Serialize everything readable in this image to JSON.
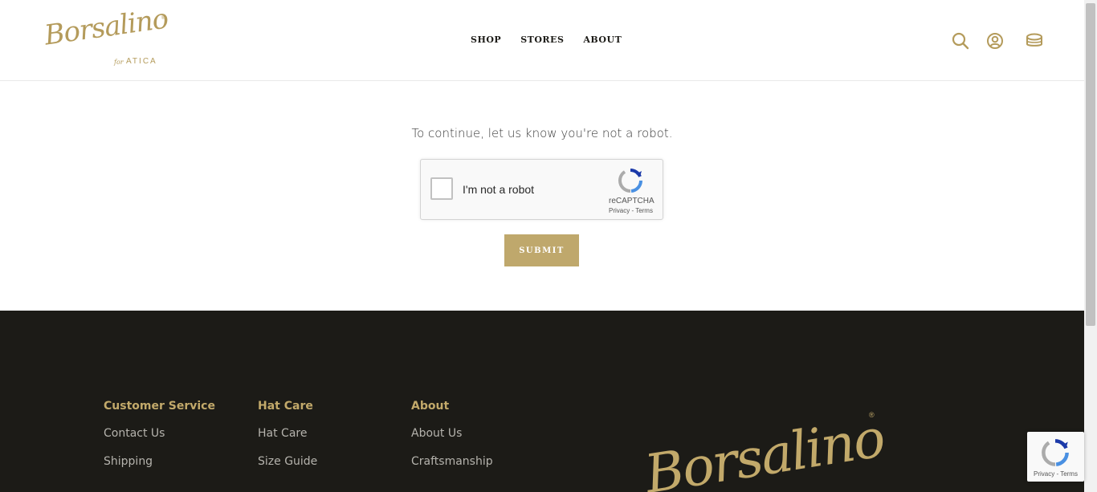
{
  "brand": {
    "script": "Borsalino",
    "reg": "®",
    "for": "for",
    "partner": "ATICA"
  },
  "nav": {
    "items": [
      "SHOP",
      "STORES",
      "ABOUT"
    ]
  },
  "header_icons": [
    "search-icon",
    "account-icon",
    "cart-icon"
  ],
  "main": {
    "prompt": "To continue, let us know you're not a robot.",
    "captcha": {
      "label": "I'm not a robot",
      "brand": "reCAPTCHA",
      "links": "Privacy - Terms"
    },
    "submit_label": "SUBMIT"
  },
  "footer": {
    "columns": [
      {
        "title": "Customer Service",
        "links": [
          "Contact Us",
          "Shipping"
        ]
      },
      {
        "title": "Hat Care",
        "links": [
          "Hat Care",
          "Size Guide"
        ]
      },
      {
        "title": "About",
        "links": [
          "About Us",
          "Craftsmanship"
        ]
      }
    ],
    "logo_script": "Borsalino",
    "logo_reg": "®"
  },
  "recaptcha_badge": {
    "links": "Privacy - Terms"
  },
  "colors": {
    "gold": "#bfa86c",
    "footer_bg": "#1c1b17",
    "nav_text": "#1c1b17"
  }
}
